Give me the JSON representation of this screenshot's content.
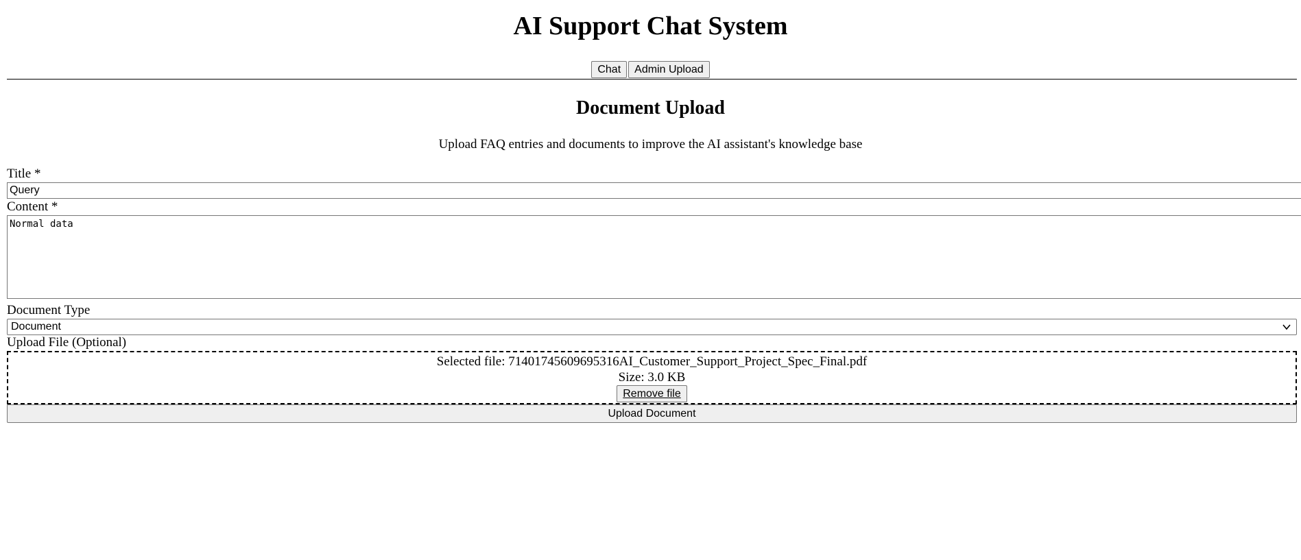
{
  "app": {
    "title": "AI Support Chat System"
  },
  "nav": {
    "chat_label": "Chat",
    "admin_upload_label": "Admin Upload"
  },
  "upload_section": {
    "title": "Document Upload",
    "description": "Upload FAQ entries and documents to improve the AI assistant's knowledge base"
  },
  "form": {
    "title_label": "Title *",
    "title_value": "Query",
    "content_label": "Content *",
    "content_value": "Normal data",
    "doc_type_label": "Document Type",
    "doc_type_selected": "Document",
    "upload_file_label": "Upload File (Optional)",
    "selected_file_text": "Selected file: 71401745609695316AI_Customer_Support_Project_Spec_Final.pdf",
    "file_size_text": "Size: 3.0 KB",
    "remove_file_label": "Remove file",
    "upload_button_label": "Upload Document"
  },
  "icons": {
    "select_arrow": "chevron-down-icon"
  }
}
